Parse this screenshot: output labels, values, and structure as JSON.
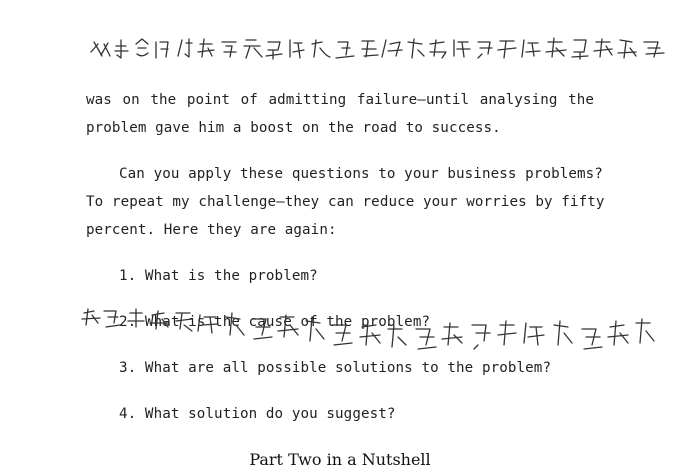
{
  "annotations": {
    "top": "双方合作的首要成果就是通过敏儿测评，得到了与以往考古研究",
    "middle": "紫色上面还不规则地分布着紫色荧光圈，除了这种紫斑，考察队"
  },
  "document": {
    "paragraph1": [
      "was on the point of admitting failure—until analysing the",
      "problem gave him a boost on the road to success."
    ],
    "paragraph2": [
      "Can you apply these questions to your business problems?",
      "To repeat my challenge—they can reduce your worries by fifty",
      "percent. Here they are again:"
    ],
    "questions": [
      "1. What is the problem?",
      "2. What is the cause of the problem?",
      "3. What are all possible solutions to the problem?",
      "4. What solution do you suggest?"
    ],
    "section_heading": "Part Two in a Nutshell"
  }
}
